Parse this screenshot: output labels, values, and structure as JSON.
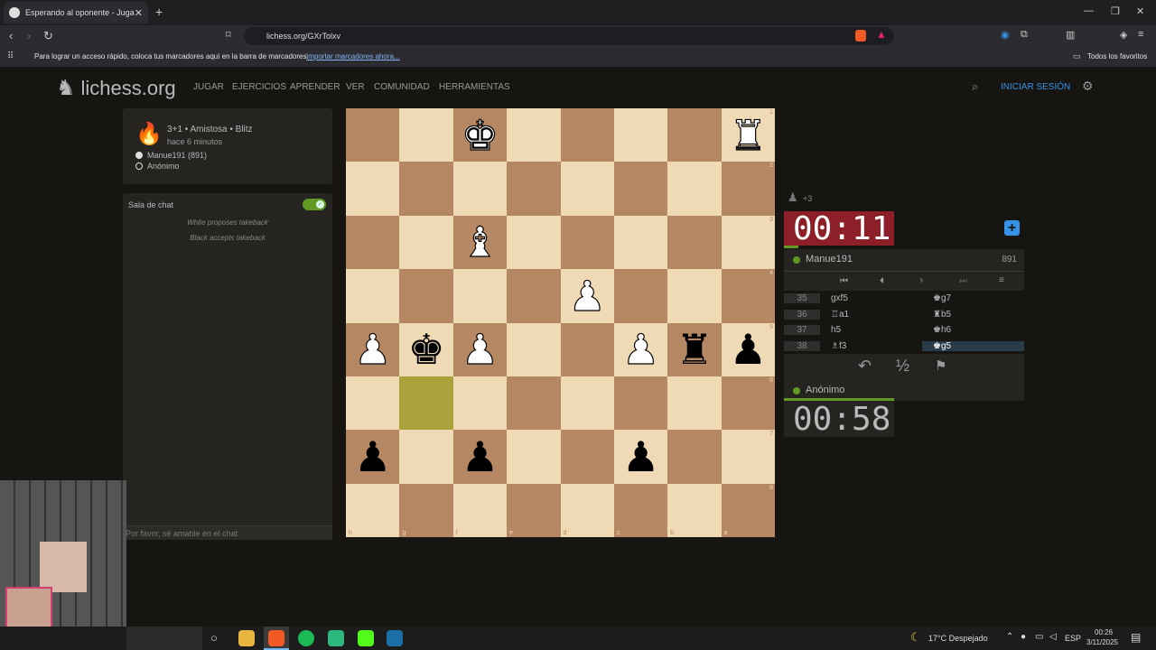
{
  "browser": {
    "tab_title": "Esperando al oponente - Jugar f",
    "url": "lichess.org/GXrTolxv",
    "bookmarks_hint": "Para lograr un acceso rápido, coloca tus marcadores aquí en la barra de marcadores.",
    "bookmarks_import": "Importar marcadores ahora...",
    "all_favorites": "Todos los favoritos"
  },
  "site": {
    "logo_text": "lichess.org",
    "nav": [
      "JUGAR",
      "EJERCICIOS",
      "APRENDER",
      "VER",
      "COMUNIDAD",
      "HERRAMIENTAS"
    ],
    "login": "INICIAR SESIÓN"
  },
  "game_info": {
    "format": "3+1 • Amistosa • Blitz",
    "time_ago": "hace 6 minutos",
    "white_player": "Manue191 (891)",
    "black_player": "Anónimo"
  },
  "chat": {
    "title": "Sala de chat",
    "messages": [
      "White proposes takeback",
      "Black accepts takeback"
    ],
    "placeholder": "Por favor, sé amable en el chat"
  },
  "board": {
    "ranks": [
      "1",
      "2",
      "3",
      "4",
      "5",
      "6",
      "7",
      "8"
    ],
    "files": [
      "h",
      "g",
      "f",
      "e",
      "d",
      "c",
      "b",
      "a"
    ],
    "highlight": [
      "g6"
    ],
    "pieces": [
      {
        "square": "f1",
        "color": "white",
        "piece": "king"
      },
      {
        "square": "a1",
        "color": "white",
        "piece": "rook"
      },
      {
        "square": "f3",
        "color": "white",
        "piece": "bishop"
      },
      {
        "square": "d4",
        "color": "white",
        "piece": "pawn"
      },
      {
        "square": "h5",
        "color": "white",
        "piece": "pawn"
      },
      {
        "square": "g5",
        "color": "black",
        "piece": "king"
      },
      {
        "square": "f5",
        "color": "white",
        "piece": "pawn"
      },
      {
        "square": "c5",
        "color": "white",
        "piece": "pawn"
      },
      {
        "square": "b5",
        "color": "black",
        "piece": "rook"
      },
      {
        "square": "a5",
        "color": "black",
        "piece": "pawn"
      },
      {
        "square": "h7",
        "color": "black",
        "piece": "pawn"
      },
      {
        "square": "f7",
        "color": "black",
        "piece": "pawn"
      },
      {
        "square": "c7",
        "color": "black",
        "piece": "pawn"
      }
    ]
  },
  "opponent_top": {
    "material": "+3",
    "clock": "00:11",
    "name": "Manue191",
    "rating": "891"
  },
  "moves": [
    {
      "n": "35",
      "w": "gxf5",
      "b": "♚g7"
    },
    {
      "n": "36",
      "w": "♖a1",
      "b": "♜b5"
    },
    {
      "n": "37",
      "w": "h5",
      "b": "♚h6"
    },
    {
      "n": "38",
      "w": "♗f3",
      "b": "♚g5"
    }
  ],
  "player_bottom": {
    "name": "Anónimo",
    "clock": "00:58"
  },
  "controls": {
    "draw": "½"
  },
  "taskbar": {
    "weather": "17°C  Despejado",
    "lang": "ESP",
    "time": "00:26",
    "date": "3/11/2025"
  },
  "colors": {
    "accent_blue": "#3692e7",
    "clock_red": "#8c1f28",
    "online_green": "#629924",
    "board_light": "#f0d9b5",
    "board_dark": "#b58863",
    "highlight": "#aaa23a"
  }
}
